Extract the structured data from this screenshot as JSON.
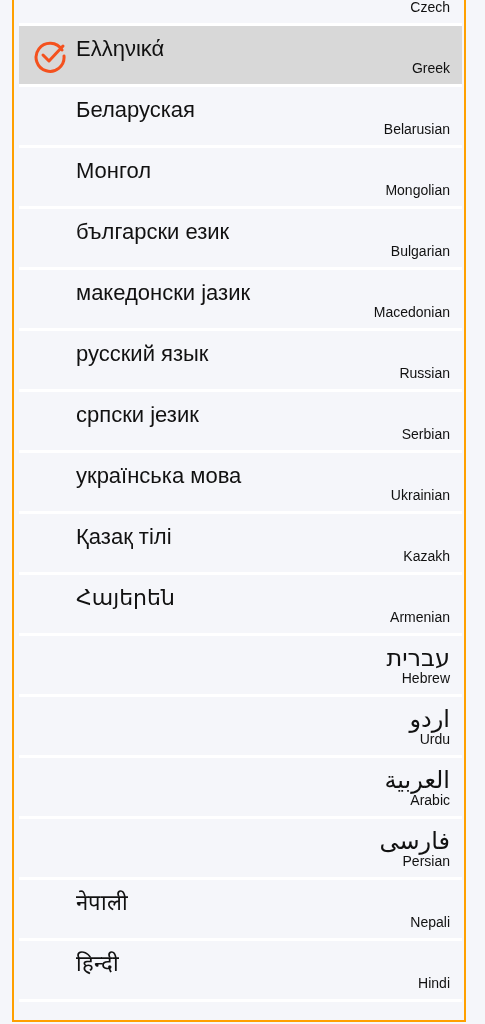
{
  "languages": [
    {
      "english": "Czech",
      "kind": "ltr",
      "selected": false
    },
    {
      "native": "Ελληνικά",
      "english": "Greek",
      "kind": "ltr",
      "selected": true
    },
    {
      "native": "Беларуская",
      "english": "Belarusian",
      "kind": "ltr",
      "selected": false
    },
    {
      "native": "Монгол",
      "english": "Mongolian",
      "kind": "ltr",
      "selected": false
    },
    {
      "native": "български език",
      "english": "Bulgarian",
      "kind": "ltr",
      "selected": false
    },
    {
      "native": "македонски јазик",
      "english": "Macedonian",
      "kind": "ltr",
      "selected": false
    },
    {
      "native": "русский язык",
      "english": "Russian",
      "kind": "ltr",
      "selected": false
    },
    {
      "native": "српски језик",
      "english": "Serbian",
      "kind": "ltr",
      "selected": false
    },
    {
      "native": "українська мова",
      "english": "Ukrainian",
      "kind": "ltr",
      "selected": false
    },
    {
      "native": "Қазақ тілі",
      "english": "Kazakh",
      "kind": "ltr",
      "selected": false
    },
    {
      "native": "Հայերեն",
      "english": "Armenian",
      "kind": "ltr",
      "selected": false
    },
    {
      "native": "עברית",
      "english": "Hebrew",
      "kind": "rtl",
      "selected": false
    },
    {
      "native": "اردو",
      "english": "Urdu",
      "kind": "rtl",
      "selected": false
    },
    {
      "native": "العربية",
      "english": "Arabic",
      "kind": "rtl",
      "selected": false
    },
    {
      "native": "فارسی",
      "english": "Persian",
      "kind": "rtl",
      "selected": false
    },
    {
      "native": "नेपाली",
      "english": "Nepali",
      "kind": "ltr",
      "selected": false
    },
    {
      "native": "हिन्दी",
      "english": "Hindi",
      "kind": "ltr",
      "selected": false
    },
    {
      "kind": "ltr",
      "selected": false
    }
  ]
}
